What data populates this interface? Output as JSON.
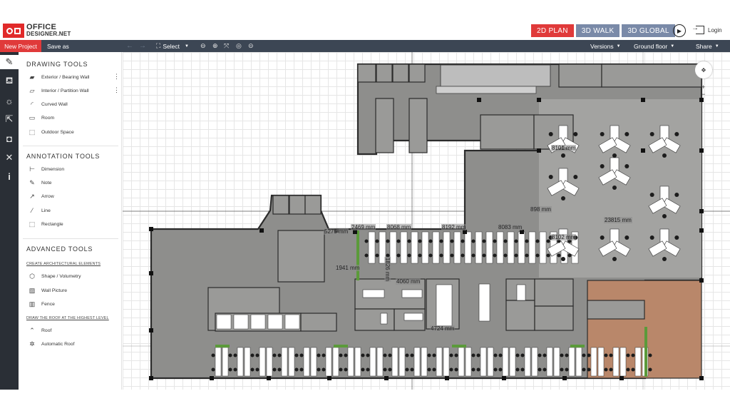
{
  "header": {
    "logo_line1": "OFFICE",
    "logo_line2": "DESIGNER.NET",
    "views": [
      {
        "label": "2D PLAN",
        "active": true
      },
      {
        "label": "3D WALK",
        "active": false
      },
      {
        "label": "3D GLOBAL",
        "active": false
      }
    ],
    "login_label": "Login"
  },
  "toolbar": {
    "new_project": "New Project",
    "save_as": "Save as",
    "select": "Select",
    "versions": "Versions",
    "floor": "Ground floor",
    "share": "Share"
  },
  "rail": [
    "ruler-pencil-icon",
    "sofa-icon",
    "sun-icon",
    "export-icon",
    "camera-icon",
    "tools-icon",
    "info-icon"
  ],
  "panel": {
    "drawing_title": "DRAWING TOOLS",
    "drawing_tools": [
      "Exterior / Bearing Wall",
      "Interior / Partition Wall",
      "Curved Wall",
      "Room",
      "Outdoor Space"
    ],
    "annotation_title": "ANNOTATION TOOLS",
    "annotation_tools": [
      "Dimension",
      "Note",
      "Arrow",
      "Line",
      "Rectangle"
    ],
    "advanced_title": "ADVANCED TOOLS",
    "arch_link": "CREATE ARCHITECTURAL ELEMENTS",
    "arch_tools": [
      "Shape / Volumetry",
      "Wall Picture",
      "Fence"
    ],
    "roof_link": "DRAW THE ROOF AT THE HIGHEST LEVEL",
    "roof_tools": [
      "Roof",
      "Automatic Roof"
    ]
  },
  "dimensions": [
    "8101 mm",
    "898 mm",
    "23815 mm",
    "8102 mm",
    "2469 mm",
    "8068 mm",
    "8192 mm",
    "8083 mm",
    "5275 mm",
    "1941 mm",
    "1826 mm",
    "4060 mm",
    "4724 mm"
  ],
  "colors": {
    "accent_red": "#e03a3a",
    "view_btn": "#7a8aa8",
    "toolbar": "#3c4654",
    "rail": "#2a2f36",
    "floor_grey": "#8e8e8c",
    "wood_floor": "#b9876a",
    "wall": "#2b2b2b"
  }
}
